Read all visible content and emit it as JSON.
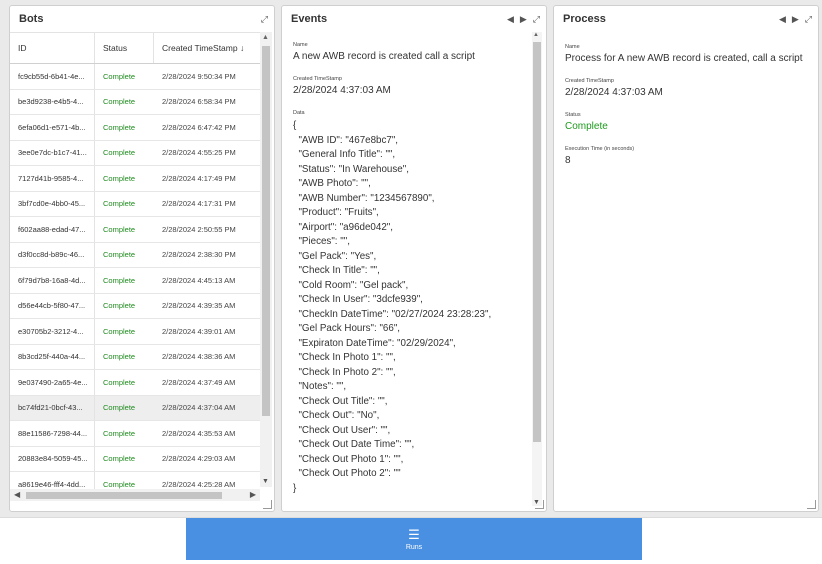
{
  "bots": {
    "title": "Bots",
    "columns": [
      "ID",
      "Status",
      "Created TimeStamp ↓"
    ],
    "rows": [
      {
        "id": "fc9cb55d-6b41-4e...",
        "status": "Complete",
        "created": "2/28/2024 9:50:34 PM"
      },
      {
        "id": "be3d9238-e4b5-4...",
        "status": "Complete",
        "created": "2/28/2024 6:58:34 PM"
      },
      {
        "id": "6efa06d1-e571-4b...",
        "status": "Complete",
        "created": "2/28/2024 6:47:42 PM"
      },
      {
        "id": "3ee0e7dc-b1c7-41...",
        "status": "Complete",
        "created": "2/28/2024 4:55:25 PM"
      },
      {
        "id": "7127d41b-9585-4...",
        "status": "Complete",
        "created": "2/28/2024 4:17:49 PM"
      },
      {
        "id": "3bf7cd0e-4bb0-45...",
        "status": "Complete",
        "created": "2/28/2024 4:17:31 PM"
      },
      {
        "id": "f602aa88-edad-47...",
        "status": "Complete",
        "created": "2/28/2024 2:50:55 PM"
      },
      {
        "id": "d3f0cc8d-b89c-46...",
        "status": "Complete",
        "created": "2/28/2024 2:38:30 PM"
      },
      {
        "id": "6f79d7b8-16a8-4d...",
        "status": "Complete",
        "created": "2/28/2024 4:45:13 AM"
      },
      {
        "id": "d56e44cb-5f80-47...",
        "status": "Complete",
        "created": "2/28/2024 4:39:35 AM"
      },
      {
        "id": "e30705b2-3212-4...",
        "status": "Complete",
        "created": "2/28/2024 4:39:01 AM"
      },
      {
        "id": "8b3cd25f-440a-44...",
        "status": "Complete",
        "created": "2/28/2024 4:38:36 AM"
      },
      {
        "id": "9e037490-2a65-4e...",
        "status": "Complete",
        "created": "2/28/2024 4:37:49 AM"
      },
      {
        "id": "bc74fd21-0bcf-43...",
        "status": "Complete",
        "created": "2/28/2024 4:37:04 AM"
      },
      {
        "id": "88e11586-7298-44...",
        "status": "Complete",
        "created": "2/28/2024 4:35:53 AM"
      },
      {
        "id": "20883e84-5059-45...",
        "status": "Complete",
        "created": "2/28/2024 4:29:03 AM"
      },
      {
        "id": "a8619e46-fff4-4dd...",
        "status": "Complete",
        "created": "2/28/2024 4:25:28 AM"
      }
    ],
    "selected_index": 13
  },
  "events": {
    "title": "Events",
    "name_label": "Name",
    "name_value": "A new AWB record is created  call a script",
    "created_label": "Created TimeStamp",
    "created_value": "2/28/2024 4:37:03 AM",
    "data_label": "Data",
    "data_lines": [
      "{",
      "  \"AWB ID\": \"467e8bc7\",",
      "  \"General Info Title\": \"\",",
      "  \"Status\": \"In Warehouse\",",
      "  \"AWB Photo\": \"\",",
      "  \"AWB Number\": \"1234567890\",",
      "  \"Product\": \"Fruits\",",
      "  \"Airport\": \"a96de042\",",
      "  \"Pieces\": \"\",",
      "  \"Gel Pack\": \"Yes\",",
      "  \"Check In Title\": \"\",",
      "  \"Cold Room\": \"Gel pack\",",
      "  \"Check In User\": \"3dcfe939\",",
      "  \"CheckIn DateTime\": \"02/27/2024 23:28:23\",",
      "  \"Gel Pack Hours\": \"66\",",
      "  \"Expiraton DateTime\": \"02/29/2024\",",
      "  \"Check In Photo 1\": \"\",",
      "  \"Check In Photo 2\": \"\",",
      "  \"Notes\": \"\",",
      "  \"Check Out Title\": \"\",",
      "  \"Check Out\": \"No\",",
      "  \"Check Out User\": \"\",",
      "  \"Check Out Date Time\": \"\",",
      "  \"Check Out Photo 1\": \"\",",
      "  \"Check Out Photo 2\": \"\"",
      "}"
    ]
  },
  "process": {
    "title": "Process",
    "name_label": "Name",
    "name_value": "Process for A new AWB record is created, call a script",
    "created_label": "Created TimeStamp",
    "created_value": "2/28/2024 4:37:03 AM",
    "status_label": "Status",
    "status_value": "Complete",
    "exec_label": "Execution Time (in seconds)",
    "exec_value": "8"
  },
  "bottom": {
    "runs_label": "Runs",
    "runs_icon": "list-icon"
  },
  "icons": {
    "expand": "⤢",
    "prev": "◀",
    "next": "▶",
    "up": "▲",
    "down": "▼",
    "left": "◀",
    "right": "▶",
    "list": "☰"
  },
  "colors": {
    "complete": "#1e8a1e",
    "accent": "#4a90e2"
  }
}
